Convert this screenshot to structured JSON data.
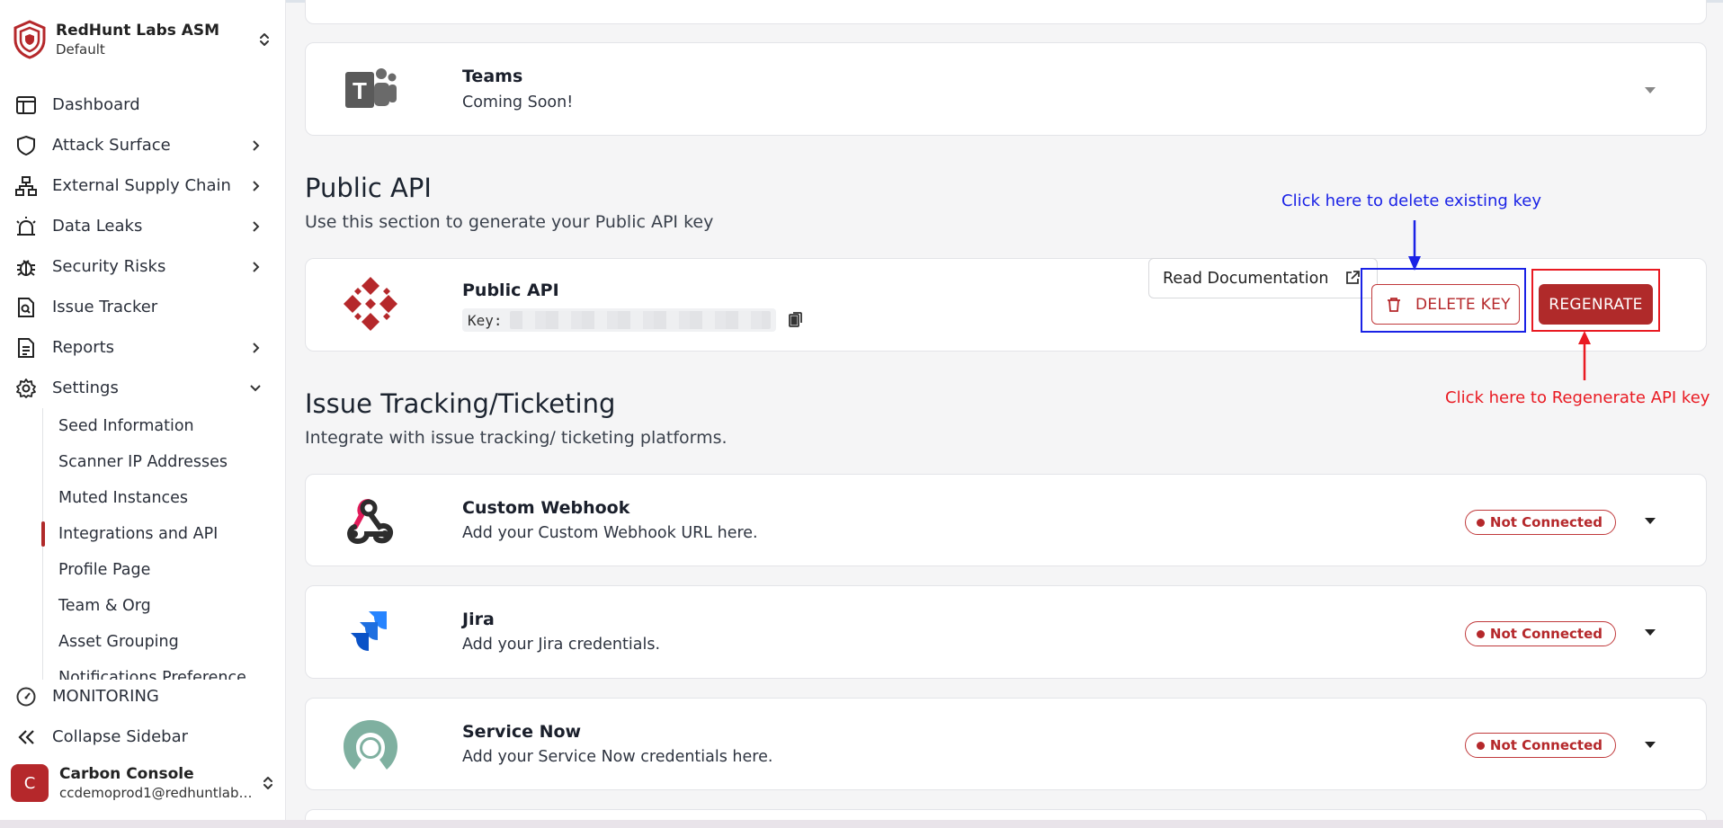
{
  "org": {
    "name": "RedHunt Labs ASM",
    "workspace": "Default"
  },
  "nav": {
    "items": [
      {
        "label": "Dashboard",
        "icon": "layout-icon"
      },
      {
        "label": "Attack Surface",
        "icon": "shield-icon"
      },
      {
        "label": "External Supply Chain",
        "icon": "network-icon"
      },
      {
        "label": "Data Leaks",
        "icon": "siren-icon"
      },
      {
        "label": "Security Risks",
        "icon": "bug-icon"
      },
      {
        "label": "Issue Tracker",
        "icon": "file-search-icon"
      },
      {
        "label": "Reports",
        "icon": "document-icon"
      },
      {
        "label": "Settings",
        "icon": "gear-icon"
      }
    ],
    "settings_sub": [
      "Seed Information",
      "Scanner IP Addresses",
      "Muted Instances",
      "Integrations and API",
      "Profile Page",
      "Team & Org",
      "Asset Grouping",
      "Notifications Preference"
    ],
    "monitoring": "MONITORING",
    "collapse": "Collapse Sidebar"
  },
  "user": {
    "initial": "C",
    "name": "Carbon Console",
    "email": "ccdemoprod1@redhuntlabs..."
  },
  "teams": {
    "title": "Teams",
    "desc": "Coming Soon!"
  },
  "public_api": {
    "section_title": "Public API",
    "section_sub": "Use this section to generate your Public API key",
    "card_title": "Public API",
    "key_label": "Key:",
    "read_docs": "Read Documentation",
    "delete_key": "DELETE KEY",
    "regenerate": "REGENRATE"
  },
  "annotations": {
    "delete": "Click here to delete existing key",
    "regenerate": "Click here to Regenerate API key"
  },
  "issue_tracking": {
    "section_title": "Issue Tracking/Ticketing",
    "section_sub": "Integrate with issue tracking/ ticketing platforms.",
    "integrations": [
      {
        "title": "Custom Webhook",
        "desc": "Add your Custom Webhook URL here.",
        "status": "Not Connected"
      },
      {
        "title": "Jira",
        "desc": "Add your Jira credentials.",
        "status": "Not Connected"
      },
      {
        "title": "Service Now",
        "desc": "Add your Service Now credentials here.",
        "status": "Not Connected"
      }
    ]
  },
  "colors": {
    "brand": "#b02a2a",
    "annotation_blue": "#1a22e6",
    "annotation_red": "#e91a22"
  }
}
